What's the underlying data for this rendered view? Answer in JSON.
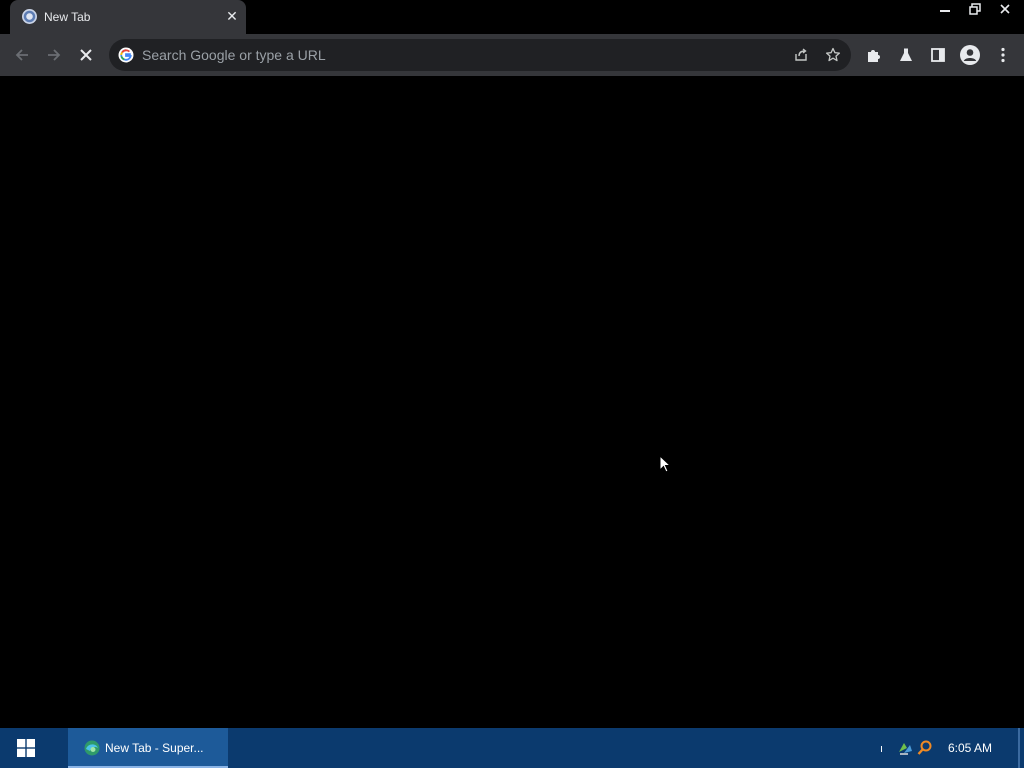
{
  "browser": {
    "tab": {
      "title": "New Tab",
      "close_glyph": "✕",
      "favicon": "chrome-newtab-icon"
    },
    "window_controls": [
      "minimize-icon",
      "restore-icon",
      "close-icon"
    ],
    "toolbar": {
      "buttons": [
        "back-arrow-icon",
        "forward-arrow-icon",
        "stop-loading-icon"
      ],
      "omnibox": {
        "placeholder": "Search Google or type a URL",
        "value": "",
        "left_icon": "google-g-icon",
        "right_icons": [
          "share-icon",
          "bookmark-star-icon"
        ]
      },
      "extension_buttons": [
        "extensions-puzzle-icon",
        "labs-flask-icon",
        "side-panel-icon",
        "profile-avatar-icon",
        "menu-kebab-icon"
      ]
    },
    "content": {
      "background": "#000000"
    }
  },
  "taskbar": {
    "start_icon": "windows-logo-icon",
    "items": [
      {
        "label": "New Tab - Super...",
        "icon": "browser-icon",
        "active": true
      }
    ],
    "tray": {
      "mark": "ı",
      "icons": [
        "network-tray-icon",
        "search-tray-icon"
      ],
      "clock": "6:05 AM"
    }
  },
  "colors": {
    "tab_bg": "#35363a",
    "toolbar_bg": "#35363a",
    "omnibox_bg": "#202124",
    "taskbar_bg": "#0b3a6e",
    "taskbar_active": "#1d5a99",
    "text_light": "#e8eaed",
    "text_muted": "#9aa0a6"
  }
}
